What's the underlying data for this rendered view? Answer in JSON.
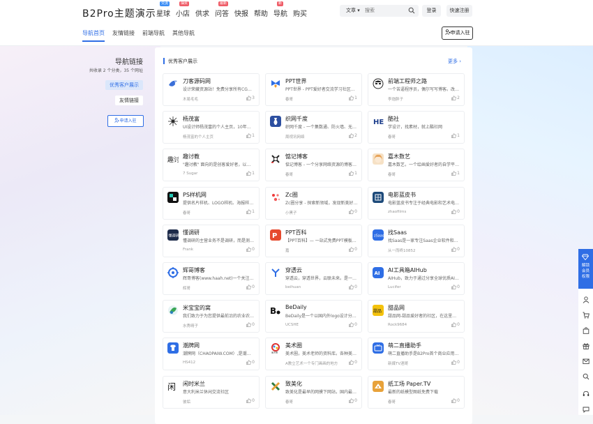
{
  "site": {
    "logo": "B2Pro主题演示"
  },
  "nav": [
    {
      "label": "星球",
      "badge": "交流",
      "badge_color": "#3c8ef5"
    },
    {
      "label": "小店",
      "badge": "抽奖",
      "badge_color": "#ef5d68"
    },
    {
      "label": "供求",
      "badge": ""
    },
    {
      "label": "问答",
      "badge": "最新",
      "badge_color": "#ef5d68"
    },
    {
      "label": "快报",
      "badge": ""
    },
    {
      "label": "帮助",
      "badge": ""
    },
    {
      "label": "导航",
      "badge": "新",
      "badge_color": "#ef5d68"
    },
    {
      "label": "购买",
      "badge": ""
    }
  ],
  "search": {
    "type": "文章",
    "placeholder": "搜索"
  },
  "auth": {
    "login": "登录",
    "register": "快速注册"
  },
  "subnav": [
    "导航首页",
    "友情链接",
    "前端导航",
    "其他导航"
  ],
  "apply_label": "申请入驻",
  "sidebar": {
    "title": "导航链接",
    "summary": "共收录 2 个分类，35 个网址",
    "categories": [
      "优秀客户展示",
      "友情链接"
    ],
    "apply": "申请入驻"
  },
  "panel": {
    "title": "优秀客户展示",
    "more": "更多"
  },
  "cards": [
    {
      "name": "刀客源码网",
      "desc": "设计荣藏资源站！免费分享所有CG…",
      "author": "木易毛毛",
      "likes": "3",
      "logo": "bird",
      "color": "#3a6fd8"
    },
    {
      "name": "PPT世界",
      "desc": "PPT世界 - PPT爱好者交流学习社区…",
      "author": "春哥",
      "likes": "1",
      "logo": "bow",
      "color": "#2f6ee5"
    },
    {
      "name": "前端工程师之路",
      "desc": "一个苦逼程序员，偶尔写写博客。改…",
      "author": "李炮胖子",
      "likes": "2",
      "logo": "face",
      "color": "#222"
    },
    {
      "name": "杨茂富",
      "desc": "UI设计师杨茂富的个人主页，10年…",
      "author": "杨茂富的个人主页",
      "likes": "1",
      "logo": "sun",
      "color": "#222"
    },
    {
      "name": "织网千度",
      "desc": "织网千度 - 一个集数通、防火墙、无…",
      "author": "周视讯网络",
      "likes": "2",
      "logo": "vase",
      "color": "#2d4fa0"
    },
    {
      "name": "酷社",
      "desc": "学设计，找素材，就上酷社网",
      "author": "春哥",
      "likes": "1",
      "logo": "he",
      "color": "#1d3e8c"
    },
    {
      "name": "趣讨教",
      "desc": "\"趣讨教\" 面向的是创客爱好者，以…",
      "author": "7 Sugar",
      "likes": "1",
      "logo": "qu",
      "color": "#222"
    },
    {
      "name": "惦记博客",
      "desc": "惦记博客 - 一个分享网络资源的博客…",
      "author": "春哥",
      "likes": "1",
      "logo": "knot",
      "color": "#222"
    },
    {
      "name": "嘉木数艺",
      "desc": "嘉木数艺，一个绘画爱好者的自学平…",
      "author": "春哥",
      "likes": "1",
      "logo": "girl",
      "color": "#e8a45a"
    },
    {
      "name": "PS样机网",
      "desc": "提供名片样机、LOGO样机、海报样…",
      "author": "春哥",
      "likes": "1",
      "logo": "ps",
      "color": "#111"
    },
    {
      "name": "Zc圈",
      "desc": "Zc圈分享 - 探索新领域，发现新美好…",
      "author": "小黑子",
      "likes": "0",
      "logo": "dots",
      "color": "#ef3b3b"
    },
    {
      "name": "电影蓝皮书",
      "desc": "电影蓝皮书专注于经典电影和艺术电…",
      "author": "zhaofilms",
      "likes": "0",
      "logo": "film",
      "color": "#1d4a7a"
    },
    {
      "name": "懂调研",
      "desc": "懂调研的主营业务不是调研，而是测…",
      "author": "Frank",
      "likes": "0",
      "logo": "dong",
      "color": "#1d2b4a"
    },
    {
      "name": "PPT百科",
      "desc": "【PPT百科】— 一站式免费PPT模板…",
      "author": "嘉",
      "likes": "0",
      "logo": "pptbk",
      "color": "#e64a2e"
    },
    {
      "name": "找Saas",
      "desc": "找Saas是一家专注Saas企业软件和…",
      "author": "从一而终10852",
      "likes": "0",
      "logo": "saas",
      "color": "#2f6ee5"
    },
    {
      "name": "辉哥博客",
      "desc": "辉哥博客(www.haah.net)一个关注…",
      "author": "辉哥",
      "likes": "0",
      "logo": "gear",
      "color": "#2f6ee5"
    },
    {
      "name": "穿透云",
      "desc": "穿透云，穿透世界，云联未来。是一…",
      "author": "beihuan",
      "likes": "0",
      "logo": "cloud",
      "color": "#2f6ee5"
    },
    {
      "name": "AI工具箱AIHub",
      "desc": "AIHub，致力于通过分享全球优质AI…",
      "author": "Lucifer",
      "likes": "0",
      "logo": "ai",
      "color": "#2f6ee5"
    },
    {
      "name": "米宝宝的窝",
      "desc": "我们致力于为您提供最前沿的农业农…",
      "author": "水秀晴子",
      "likes": "0",
      "logo": "leaf",
      "color": "#3aa655"
    },
    {
      "name": "BeDaily",
      "desc": "BeDaily是一个以国内外logo设计分…",
      "author": "UCSHE",
      "likes": "0",
      "logo": "be",
      "color": "#111"
    },
    {
      "name": "甜品网",
      "desc": "甜品网-甜品爱好者的社区，在这里…",
      "author": "Rock9684",
      "likes": "0",
      "logo": "sweet",
      "color": "#f4c20d"
    },
    {
      "name": "潮牌网",
      "desc": "潮牌网（CHAOPAIW.COM）,是潮…",
      "author": "HS412",
      "likes": "0",
      "logo": "shirt",
      "color": "#2f6ee5"
    },
    {
      "name": "美术圈",
      "desc": "美术圈，美术老师的资料库。各种美…",
      "author": "A教立艺术一个专门画画的地方",
      "likes": "0",
      "logo": "circle",
      "color": "#d33"
    },
    {
      "name": "萌二直播助手",
      "desc": "萌二直播助手是B2Pro首个商业应用…",
      "author": "新媒TV酒哥",
      "likes": "0",
      "logo": "tv",
      "color": "#2f6ee5"
    },
    {
      "name": "闲时米兰",
      "desc": "意大利米兰休闲交流社区",
      "author": "彼垢",
      "likes": "0",
      "logo": "xian",
      "color": "#111"
    },
    {
      "name": "致美化",
      "desc": "致美化是最早的网摸下网站，国内最专…",
      "author": "春哥",
      "likes": "0",
      "logo": "xmark",
      "color": "#2d7a3e"
    },
    {
      "name": "纸工场 Paper.TV",
      "desc": "最新的纸模型图纸免费下载",
      "author": "春哥",
      "likes": "0",
      "logo": "paper",
      "color": "#e8a23a"
    }
  ],
  "float_bar": {
    "vip": "解锁会员权限"
  }
}
